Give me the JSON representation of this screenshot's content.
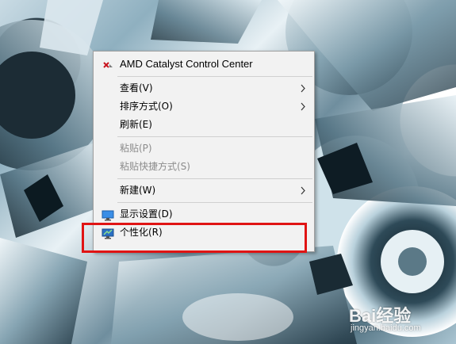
{
  "context_menu": {
    "items": [
      {
        "label": "AMD Catalyst Control Center",
        "icon": "amd-icon",
        "enabled": true,
        "submenu": false
      },
      {
        "label": "查看(V)",
        "enabled": true,
        "submenu": true
      },
      {
        "label": "排序方式(O)",
        "enabled": true,
        "submenu": true
      },
      {
        "label": "刷新(E)",
        "enabled": true,
        "submenu": false
      },
      {
        "label": "粘贴(P)",
        "enabled": false,
        "submenu": false
      },
      {
        "label": "粘贴快捷方式(S)",
        "enabled": false,
        "submenu": false
      },
      {
        "label": "新建(W)",
        "enabled": true,
        "submenu": true
      },
      {
        "label": "显示设置(D)",
        "icon": "display-settings-icon",
        "enabled": true,
        "submenu": false
      },
      {
        "label": "个性化(R)",
        "icon": "personalize-icon",
        "enabled": true,
        "submenu": false
      }
    ],
    "highlighted_item": "个性化(R)"
  },
  "colors": {
    "highlight_box": "#e01414",
    "menu_background": "#f2f2f2",
    "disabled_text": "#8c8c8c"
  },
  "watermark": {
    "logo_text": "Bai经验",
    "url": "jingyan.baidu.com"
  }
}
